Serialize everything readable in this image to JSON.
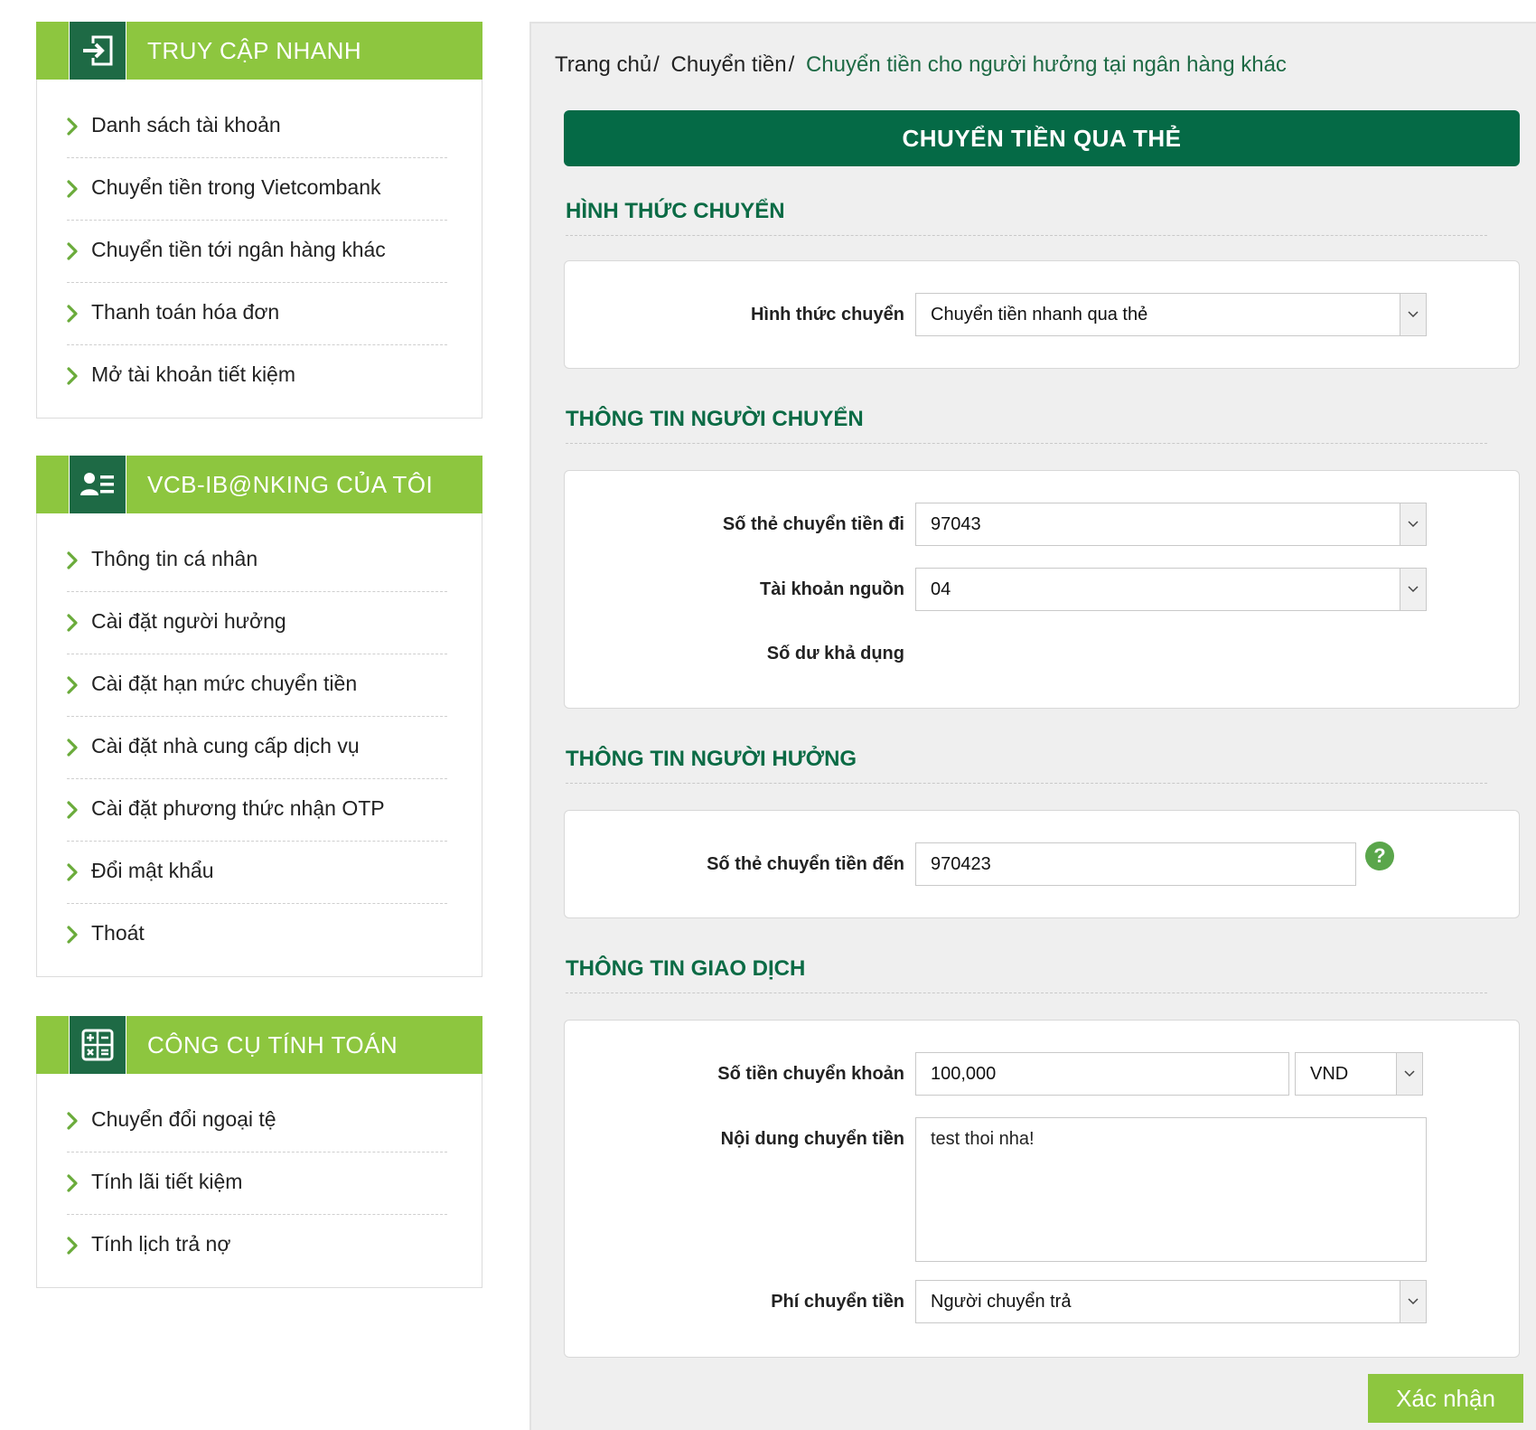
{
  "sidebar": {
    "quick_access": {
      "title": "TRUY CẬP NHANH",
      "icon": "login-arrow-icon",
      "items": [
        {
          "label": "Danh sách tài khoản"
        },
        {
          "label": "Chuyển tiền trong Vietcombank"
        },
        {
          "label": "Chuyển tiền tới ngân hàng khác"
        },
        {
          "label": "Thanh toán hóa đơn"
        },
        {
          "label": "Mở tài khoản tiết kiệm"
        }
      ]
    },
    "my_banking": {
      "title": "VCB-IB@NKING CỦA TÔI",
      "icon": "user-profile-icon",
      "items": [
        {
          "label": "Thông tin cá nhân"
        },
        {
          "label": "Cài đặt người hưởng"
        },
        {
          "label": "Cài đặt hạn mức chuyển tiền"
        },
        {
          "label": "Cài đặt nhà cung cấp dịch vụ"
        },
        {
          "label": "Cài đặt phương thức nhận OTP"
        },
        {
          "label": "Đổi mật khẩu"
        },
        {
          "label": "Thoát"
        }
      ]
    },
    "tools": {
      "title": "CÔNG CỤ TÍNH TOÁN",
      "icon": "calculator-icon",
      "items": [
        {
          "label": "Chuyển đổi ngoại tệ"
        },
        {
          "label": "Tính lãi tiết kiệm"
        },
        {
          "label": "Tính lịch trả nợ"
        }
      ]
    }
  },
  "breadcrumb": {
    "home": "Trang chủ",
    "transfer": "Chuyển tiền",
    "current": "Chuyển tiền cho người hưởng tại ngân hàng khác",
    "separator": "/"
  },
  "banner": "CHUYỂN TIỀN QUA THẺ",
  "sections": {
    "method": {
      "title": "HÌNH THỨC CHUYỂN",
      "label": "Hình thức chuyển",
      "value": "Chuyển tiền nhanh qua thẻ"
    },
    "sender": {
      "title": "THÔNG TIN NGƯỜI CHUYỂN",
      "card_label": "Số thẻ chuyển tiền đi",
      "card_value": "97043",
      "account_label": "Tài khoản nguồn",
      "account_value": "04",
      "balance_label": "Số dư khả dụng"
    },
    "beneficiary": {
      "title": "THÔNG TIN NGƯỜI HƯỞNG",
      "card_label": "Số thẻ chuyển tiền đến",
      "card_value": "970423",
      "help": "?"
    },
    "transaction": {
      "title": "THÔNG TIN GIAO DỊCH",
      "amount_label": "Số tiền chuyển khoản",
      "amount_value": "100,000",
      "currency": "VND",
      "content_label": "Nội dung chuyển tiền",
      "content_value": "test thoi nha!",
      "fee_label": "Phí chuyển tiền",
      "fee_value": "Người chuyển trả"
    }
  },
  "submit_label": "Xác nhận",
  "colors": {
    "brand_green": "#056a46",
    "accent_green": "#8dc63f",
    "section_green": "#0b6b45"
  }
}
